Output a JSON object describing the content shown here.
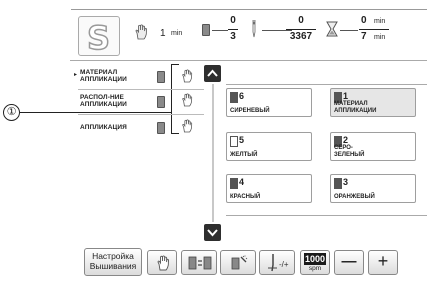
{
  "header": {
    "time_value": "1",
    "time_unit": "min",
    "color_index": "0",
    "color_total": "3",
    "stitch_current": "0",
    "stitch_total": "3367",
    "time_elapsed": "0",
    "time_total": "7",
    "time_elapsed_unit": "min",
    "time_total_unit": "min"
  },
  "callout": {
    "label": "①"
  },
  "layers": [
    {
      "label": "МАТЕРИАЛ\nАППЛИКАЦИИ",
      "selected": true
    },
    {
      "label": "РАСПОЛ-НИЕ\nАППЛИКАЦИИ",
      "selected": false
    },
    {
      "label": "АППЛИКАЦИЯ",
      "selected": false
    }
  ],
  "colors": [
    {
      "num": "6",
      "name": "СИРЕНЕВЫЙ",
      "swatch": "dark"
    },
    {
      "num": "1",
      "name": "МАТЕРИАЛ\nАППЛИКАЦИИ",
      "swatch": "dark",
      "selected": true
    },
    {
      "num": "5",
      "name": "ЖЕЛТЫЙ",
      "swatch": "light"
    },
    {
      "num": "2",
      "name": "СЕРО-\nЗЕЛЕНЫЙ",
      "swatch": "dark"
    },
    {
      "num": "4",
      "name": "КРАСНЫЙ",
      "swatch": "dark"
    },
    {
      "num": "3",
      "name": "ОРАНЖЕВЫЙ",
      "swatch": "dark"
    }
  ],
  "toolbar": {
    "settings_label": "Настройка\nВышивания",
    "speed_value": "1000",
    "speed_unit": "spm",
    "minus_label": "—",
    "plus_label": "+"
  }
}
